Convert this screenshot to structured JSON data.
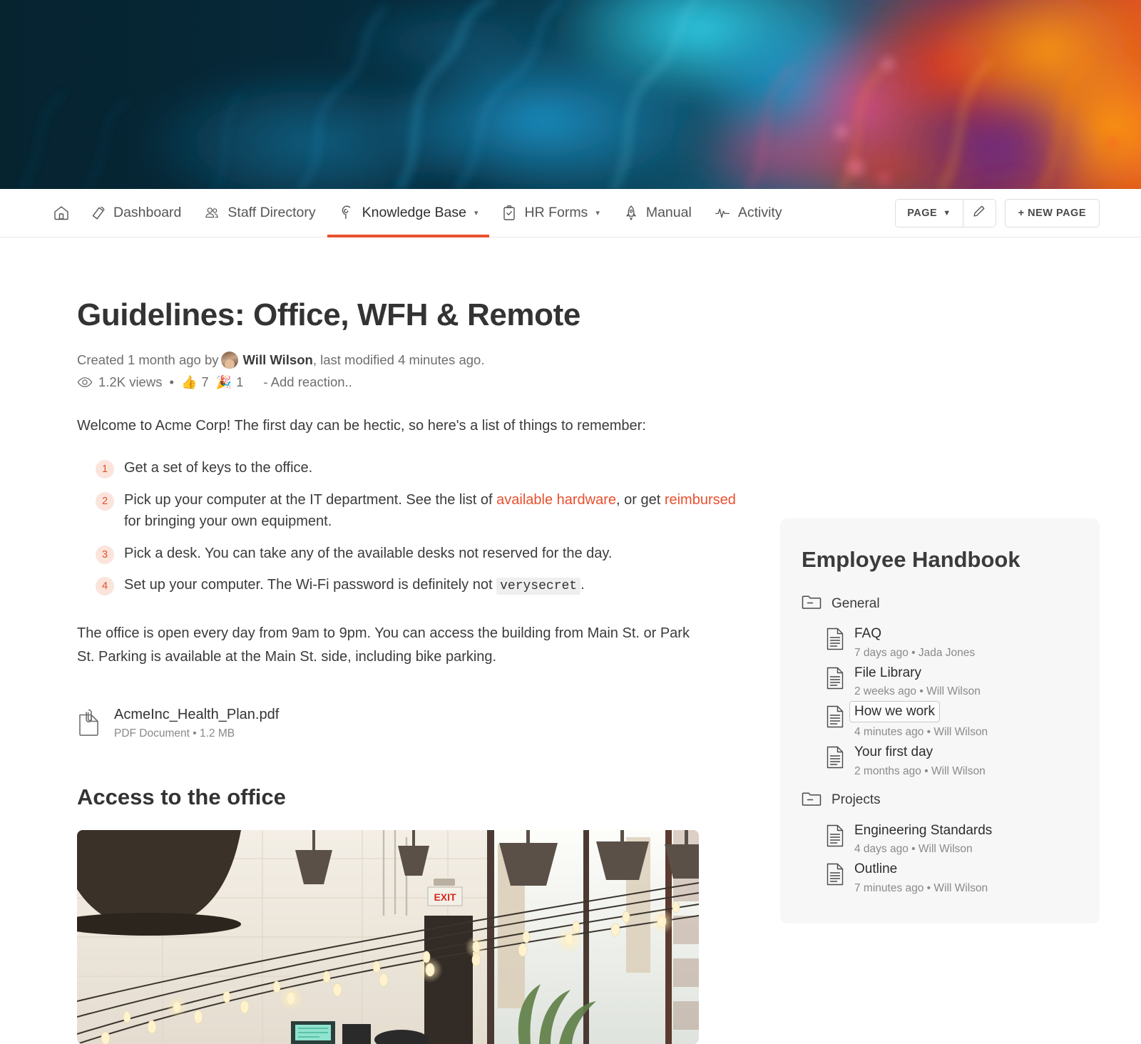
{
  "banner": {
    "alt": "abstract blue and orange ink smoke banner"
  },
  "nav": {
    "items": [
      {
        "label": "",
        "icon": "home-icon",
        "name": "nav-home",
        "active": false,
        "caret": false
      },
      {
        "label": "Dashboard",
        "icon": "megaphone-icon",
        "name": "nav-dashboard",
        "active": false,
        "caret": false
      },
      {
        "label": "Staff Directory",
        "icon": "people-icon",
        "name": "nav-staff-directory",
        "active": false,
        "caret": false
      },
      {
        "label": "Knowledge Base",
        "icon": "brain-icon",
        "name": "nav-knowledge-base",
        "active": true,
        "caret": true
      },
      {
        "label": "HR Forms",
        "icon": "clipboard-check-icon",
        "name": "nav-hr-forms",
        "active": false,
        "caret": true
      },
      {
        "label": "Manual",
        "icon": "rocket-icon",
        "name": "nav-manual",
        "active": false,
        "caret": false
      },
      {
        "label": "Activity",
        "icon": "pulse-icon",
        "name": "nav-activity",
        "active": false,
        "caret": false
      }
    ],
    "page_button": "PAGE",
    "page_caret": "▼",
    "edit_icon": "pencil-icon",
    "new_page_button": "+ NEW PAGE"
  },
  "article": {
    "title": "Guidelines: Office, WFH & Remote",
    "meta": {
      "created_prefix": "Created 1 month ago by",
      "author": "Will Wilson",
      "modified_suffix": ", last modified 4 minutes ago."
    },
    "stats": {
      "views": "1.2K views",
      "separator": "•",
      "thumbs_emoji": "👍",
      "thumbs_count": "7",
      "party_emoji": "🎉",
      "party_count": "1",
      "add_reaction": "- Add reaction.."
    },
    "intro": "Welcome to Acme Corp! The first day can be hectic, so here's a list of things to remember:",
    "steps": [
      {
        "num": "1",
        "pre": "Get a set of keys to the office.",
        "link1": "",
        "mid": "",
        "link2": "",
        "post": "",
        "code": ""
      },
      {
        "num": "2",
        "pre": "Pick up your computer at the IT department. See the list of ",
        "link1": "available hardware",
        "mid": ", or get ",
        "link2": "reimbursed",
        "post": " for bringing your own equipment.",
        "code": ""
      },
      {
        "num": "3",
        "pre": "Pick a desk. You can take any of the available desks not reserved for the day.",
        "link1": "",
        "mid": "",
        "link2": "",
        "post": "",
        "code": ""
      },
      {
        "num": "4",
        "pre": "Set up your computer. The Wi-Fi password is definitely not ",
        "link1": "",
        "mid": "",
        "link2": "",
        "code": "verysecret",
        "post": "."
      }
    ],
    "paragraph2": "The office is open every day from 9am to 9pm. You can access the building from Main St. or Park St. Parking is available at the Main St. side, including bike parking.",
    "attachment": {
      "icon": "paperclip-file-icon",
      "name": "AcmeInc_Health_Plan.pdf",
      "meta": "PDF Document • 1.2 MB"
    },
    "section_heading": "Access to the office",
    "photo_alt": "office interior with pendant lamps and string lights"
  },
  "sidebar": {
    "title": "Employee Handbook",
    "groups": [
      {
        "folder": "General",
        "docs": [
          {
            "name": "FAQ",
            "meta": "7 days ago • Jada Jones",
            "selected": false
          },
          {
            "name": "File Library",
            "meta": "2 weeks ago • Will Wilson",
            "selected": false
          },
          {
            "name": "How we work",
            "meta": "4 minutes ago • Will Wilson",
            "selected": true
          },
          {
            "name": "Your first day",
            "meta": "2 months ago • Will Wilson",
            "selected": false
          }
        ]
      },
      {
        "folder": "Projects",
        "docs": [
          {
            "name": "Engineering Standards",
            "meta": "4 days ago • Will Wilson",
            "selected": false
          },
          {
            "name": "Outline",
            "meta": "7 minutes ago • Will Wilson",
            "selected": false
          }
        ]
      }
    ]
  },
  "colors": {
    "accent": "#e8502e",
    "link": "#e8502e",
    "badge_bg": "#fbe4dc",
    "panel_bg": "#f7f7f7",
    "text": "#3b3b3b",
    "muted": "#8a8a8a"
  }
}
